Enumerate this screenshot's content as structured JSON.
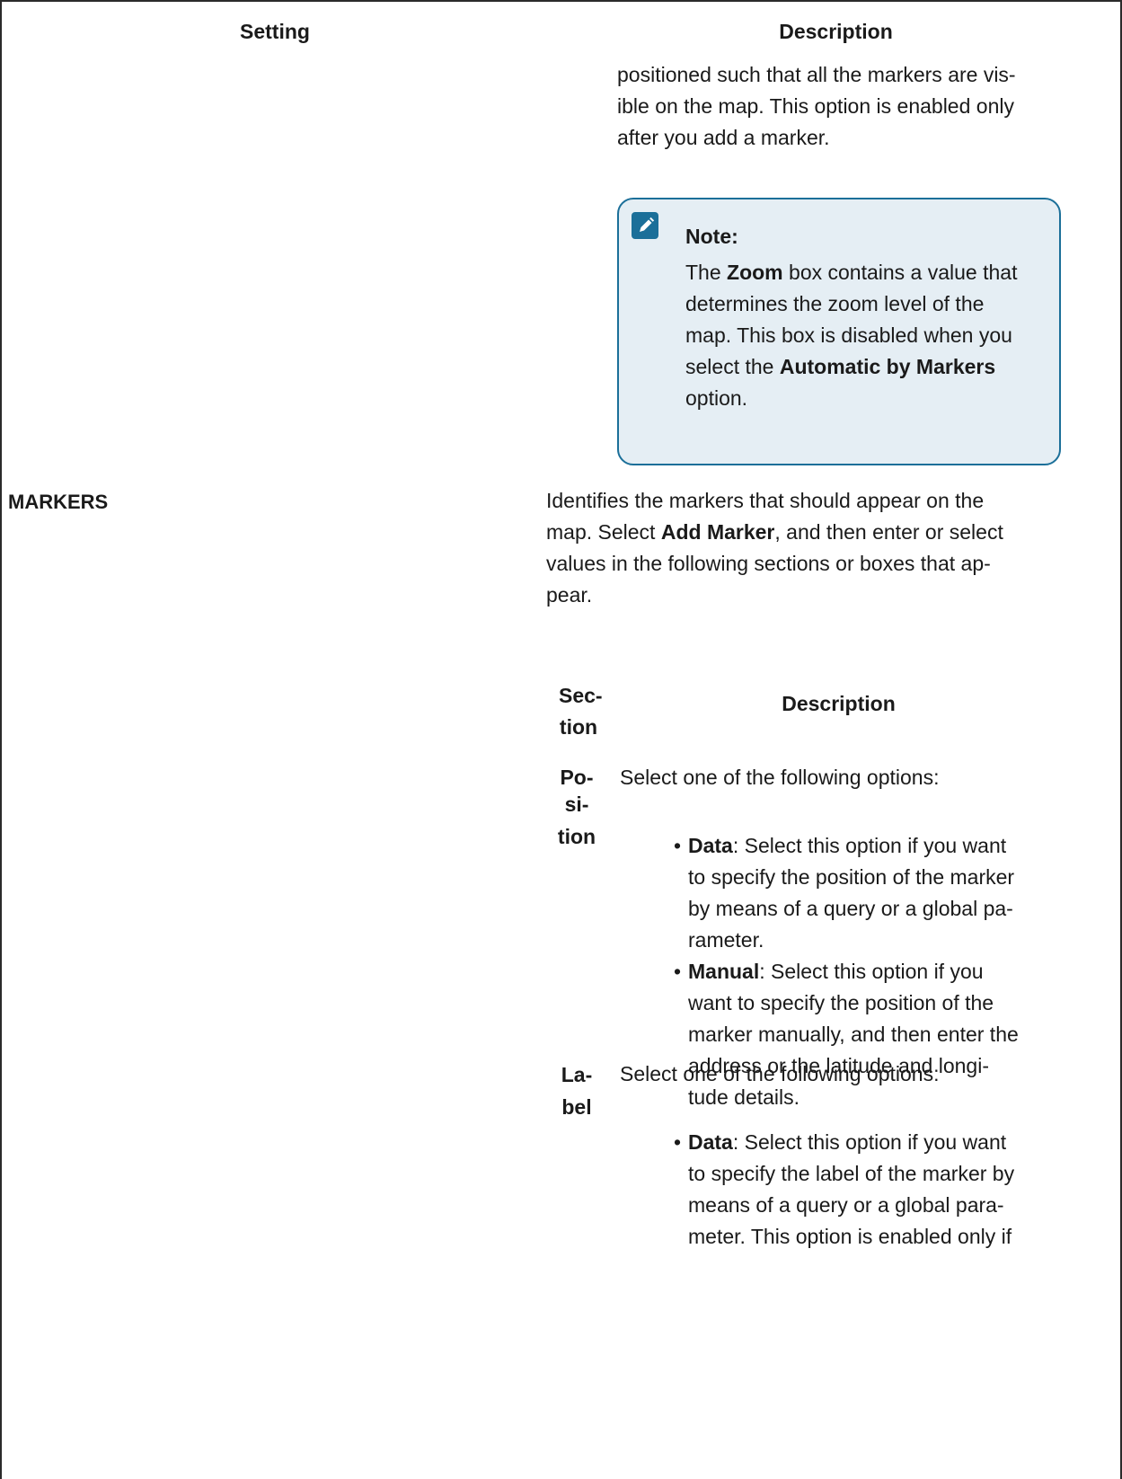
{
  "table": {
    "header_setting": "Setting",
    "header_description": "Description"
  },
  "zoom_row": {
    "continuation_text": "positioned such that all the markers are vis-ible on the map. This option is enabled only after you add a marker.",
    "lines": [
      "positioned such that all the markers are vis-",
      "ible on the map. This option is enabled only",
      "after you add a marker."
    ],
    "note": {
      "title": "Note:",
      "lines": [
        [
          {
            "t": "The "
          },
          {
            "t": "Zoom",
            "b": true
          },
          {
            "t": " box contains a value that"
          }
        ],
        [
          {
            "t": "determines the zoom level of the"
          }
        ],
        [
          {
            "t": "map. This box is disabled when you"
          }
        ],
        [
          {
            "t": "select the "
          },
          {
            "t": "Automatic by Markers",
            "b": true
          }
        ],
        [
          {
            "t": "option."
          }
        ]
      ]
    }
  },
  "markers_row": {
    "setting": "MARKERS",
    "description_lines": [
      [
        {
          "t": "Identifies the markers that should appear on the"
        }
      ],
      [
        {
          "t": "map. Select "
        },
        {
          "t": "Add Marker",
          "b": true
        },
        {
          "t": ", and then enter or select"
        }
      ],
      [
        {
          "t": "values in the following sections or boxes that ap-"
        }
      ],
      [
        {
          "t": "pear."
        }
      ]
    ],
    "subtable": {
      "header_section_lines": [
        "Sec-",
        "tion"
      ],
      "header_description": "Description",
      "rows": [
        {
          "name_lines": [
            "Po-",
            "si-",
            "tion"
          ],
          "lead": "Select one of the following options:",
          "bullets": [
            {
              "label": "Data",
              "lines": [
                ": Select this option if you want",
                "to specify the position of the marker",
                "by means of a query or a global pa-",
                "rameter."
              ]
            },
            {
              "label": "Manual",
              "lines": [
                ": Select this option if you",
                "want to specify the position of the",
                "marker manually, and then enter the",
                "address or the latitude and longi-",
                "tude details."
              ]
            }
          ]
        },
        {
          "name_lines": [
            "La-",
            "bel"
          ],
          "lead": "Select one of the following options:",
          "bullets": [
            {
              "label": "Data",
              "lines": [
                ": Select this option if you want",
                "to specify the label of the marker by",
                "means of a query or a global para-",
                "meter. This option is enabled only if"
              ]
            }
          ]
        }
      ]
    }
  },
  "colors": {
    "note_border": "#1b6f99",
    "note_background": "#e5eef4",
    "text": "#1a1a1a",
    "rule": "#2b2b2b"
  },
  "icons": {
    "note_icon": "pencil-icon"
  }
}
